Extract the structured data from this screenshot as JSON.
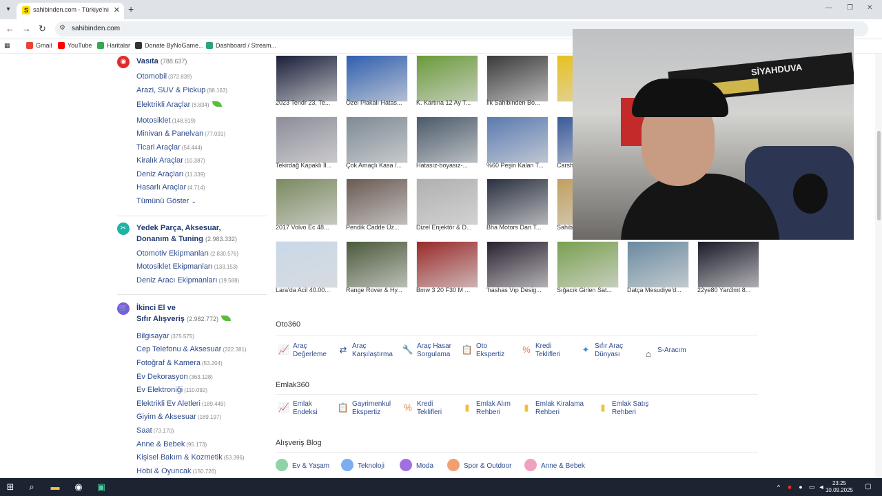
{
  "browser": {
    "tab_title": "sahibinden.com - Türkiye'nin Ö",
    "tab_favicon": "S",
    "url": "sahibinden.com",
    "bookmarks": [
      {
        "label": "Gmail",
        "color": "#ea4335"
      },
      {
        "label": "YouTube",
        "color": "#ff0000"
      },
      {
        "label": "Haritalar",
        "color": "#34a853"
      },
      {
        "label": "Donate ByNoGame...",
        "color": "#333333"
      },
      {
        "label": "Dashboard / Stream...",
        "color": "#2aa57c"
      }
    ]
  },
  "categories": {
    "vasita": {
      "title": "Vasıta",
      "count": "(788.637)",
      "items": [
        {
          "label": "Otomobil",
          "count": "(372.839)"
        },
        {
          "label": "Arazi, SUV & Pickup",
          "count": "(88.163)"
        },
        {
          "label": "Elektrikli Araçlar",
          "count": "(8.834)"
        },
        {
          "label": "Motosiklet",
          "count": "(148.819)"
        },
        {
          "label": "Minivan & Panelvan",
          "count": "(77.091)"
        },
        {
          "label": "Ticari Araçlar",
          "count": "(54.444)"
        },
        {
          "label": "Kiralık Araçlar",
          "count": "(10.387)"
        },
        {
          "label": "Deniz Araçları",
          "count": "(11.339)"
        },
        {
          "label": "Hasarlı Araçlar",
          "count": "(4.714)"
        }
      ],
      "show_all": "Tümünü Göster"
    },
    "yedek": {
      "title_line1": "Yedek Parça, Aksesuar,",
      "title_line2": "Donanım & Tuning",
      "count": "(2.983.332)",
      "items": [
        {
          "label": "Otomotiv Ekipmanları",
          "count": "(2.830.576)"
        },
        {
          "label": "Motosiklet Ekipmanları",
          "count": "(133.153)"
        },
        {
          "label": "Deniz Aracı Ekipmanları",
          "count": "(19.588)"
        }
      ]
    },
    "ikinci": {
      "title_line1": "İkinci El ve",
      "title_line2": "Sıfır Alışveriş",
      "count": "(2.982.772)",
      "items": [
        {
          "label": "Bilgisayar",
          "count": "(375.575)"
        },
        {
          "label": "Cep Telefonu & Aksesuar",
          "count": "(322.381)"
        },
        {
          "label": "Fotoğraf & Kamera",
          "count": "(53.204)"
        },
        {
          "label": "Ev Dekorasyon",
          "count": "(363.128)"
        },
        {
          "label": "Ev Elektroniği",
          "count": "(110.092)"
        },
        {
          "label": "Elektrikli Ev Aletleri",
          "count": "(189.449)"
        },
        {
          "label": "Giyim & Aksesuar",
          "count": "(189.197)"
        },
        {
          "label": "Saat",
          "count": "(73.170)"
        },
        {
          "label": "Anne & Bebek",
          "count": "(95.173)"
        },
        {
          "label": "Kişisel Bakım & Kozmetik",
          "count": "(53.396)"
        },
        {
          "label": "Hobi & Oyuncak",
          "count": "(150.726)"
        }
      ]
    }
  },
  "showcase": [
    {
      "caption": "2023 Tendr 23, Te...",
      "color": "#1a1f3a"
    },
    {
      "caption": "Özel Plakalı Hatas...",
      "color": "#2f5fb0"
    },
    {
      "caption": "K. Kartına 12 Ay T...",
      "color": "#6a9a3a"
    },
    {
      "caption": "İlk Sahibinden Bo...",
      "color": "#3a3a3a"
    },
    {
      "caption": "Tekirdağ Kapaklı İl...",
      "color": "#8d8d9a"
    },
    {
      "caption": "Çok Amaçlı Kasa /...",
      "color": "#7d8a95"
    },
    {
      "caption": "Hatasız-boyasız-...",
      "color": "#4a5a6a"
    },
    {
      "caption": "%60 Peşin Kalan T...",
      "color": "#5a7ab0"
    },
    {
      "caption": "2017 Volvo Ec 48...",
      "color": "#7b8a60"
    },
    {
      "caption": "Pendik Cadde Üz...",
      "color": "#6a5a52"
    },
    {
      "caption": "Dizel Enjektör & D...",
      "color": "#b0b0b0"
    },
    {
      "caption": "Bha Motors Dan T...",
      "color": "#2a3040"
    },
    {
      "caption": "Lara'da Acil 40.00...",
      "color": "#c8d8e8"
    },
    {
      "caption": "Range Rover & Hy...",
      "color": "#4a5a3a"
    },
    {
      "caption": "Bmw 3 20 F30 M ...",
      "color": "#9a2a2a"
    },
    {
      "caption": "'hashas Vıp Desig...",
      "color": "#2a2030"
    },
    {
      "caption": "Sığacık Girlen Sat...",
      "color": "#7aa050"
    },
    {
      "caption": "Datça Mesudiye'd...",
      "color": "#6a8aa0"
    },
    {
      "caption": "22ye80 Yan3mt 8...",
      "color": "#1a1a2a"
    }
  ],
  "showcase_partial": [
    {
      "caption": "",
      "color": "#e8c020",
      "logo": "yep"
    },
    {
      "caption": "Carsh",
      "color": "#3a5a9a"
    },
    {
      "caption": "Sahib",
      "color": "#c0a060"
    }
  ],
  "oto360": {
    "title": "Oto360",
    "links": [
      {
        "l1": "Araç",
        "l2": "Değerleme",
        "icon": "chart-icon"
      },
      {
        "l1": "Araç",
        "l2": "Karşılaştırma",
        "icon": "compare-icon"
      },
      {
        "l1": "Araç Hasar",
        "l2": "Sorgulama",
        "icon": "wrench-icon"
      },
      {
        "l1": "Oto",
        "l2": "Ekspertiz",
        "icon": "clipboard-icon"
      },
      {
        "l1": "Kredi",
        "l2": "Teklifleri",
        "icon": "percent-icon"
      },
      {
        "l1": "Sıfır Araç",
        "l2": "Dünyası",
        "icon": "sparkle-icon"
      },
      {
        "l1": "S-Aracım",
        "l2": "",
        "icon": "garage-icon"
      }
    ]
  },
  "emlak360": {
    "title": "Emlak360",
    "links": [
      {
        "l1": "Emlak",
        "l2": "Endeksi",
        "icon": "chart-icon"
      },
      {
        "l1": "Gayrimenkul",
        "l2": "Ekspertiz",
        "icon": "clipboard-icon"
      },
      {
        "l1": "Kredi",
        "l2": "Teklifleri",
        "icon": "percent-icon"
      },
      {
        "l1": "Emlak Alım",
        "l2": "Rehberi",
        "icon": "book-icon"
      },
      {
        "l1": "Emlak Kiralama",
        "l2": "Rehberi",
        "icon": "book-icon"
      },
      {
        "l1": "Emlak Satış",
        "l2": "Rehberi",
        "icon": "book-icon"
      }
    ]
  },
  "blog": {
    "title": "Alışveriş Blog",
    "items": [
      {
        "label": "Ev & Yaşam",
        "color": "#8fd3a8"
      },
      {
        "label": "Teknoloji",
        "color": "#7aaef0"
      },
      {
        "label": "Moda",
        "color": "#a070e0"
      },
      {
        "label": "Spor & Outdoor",
        "color": "#f0a070"
      },
      {
        "label": "Anne & Bebek",
        "color": "#f0a0c0"
      }
    ]
  },
  "taskbar": {
    "time": "23:25",
    "date": "10.09.2025"
  }
}
